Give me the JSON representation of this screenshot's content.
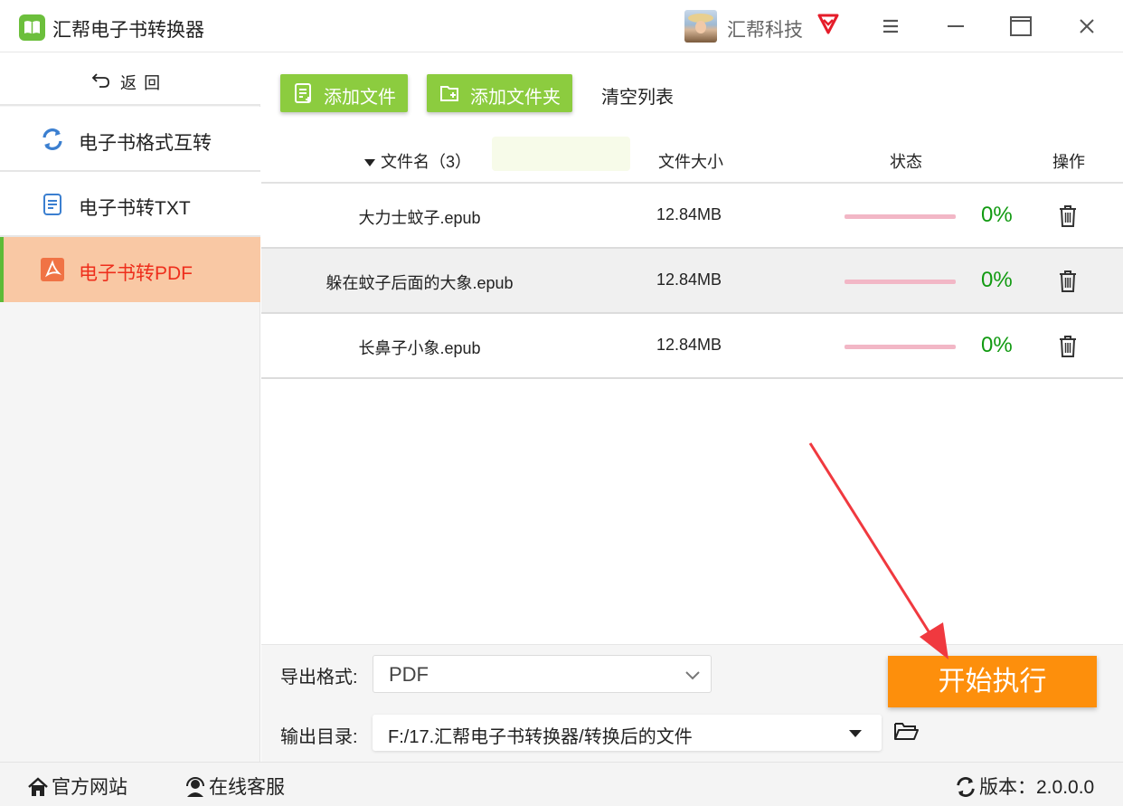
{
  "app": {
    "title": "汇帮电子书转换器",
    "company": "汇帮科技"
  },
  "sidebar": {
    "back_label": "返回",
    "items": [
      {
        "label": "电子书格式互转",
        "icon": "refresh-icon",
        "active": false
      },
      {
        "label": "电子书转TXT",
        "icon": "document-icon",
        "active": false
      },
      {
        "label": "电子书转PDF",
        "icon": "pdf-icon",
        "active": true
      }
    ]
  },
  "toolbar": {
    "add_file": "添加文件",
    "add_folder": "添加文件夹",
    "clear_list": "清空列表"
  },
  "table": {
    "headers": {
      "name": "文件名（3）",
      "size": "文件大小",
      "status": "状态",
      "action": "操作"
    },
    "rows": [
      {
        "name": "大力士蚊子.epub",
        "size": "12.84MB",
        "progress": 0,
        "percent": "0%"
      },
      {
        "name": "躲在蚊子后面的大象.epub",
        "size": "12.84MB",
        "progress": 0,
        "percent": "0%"
      },
      {
        "name": "长鼻子小象.epub",
        "size": "12.84MB",
        "progress": 0,
        "percent": "0%"
      }
    ]
  },
  "settings": {
    "format_label": "导出格式:",
    "format_value": "PDF",
    "output_label": "输出目录:",
    "output_value": "F:/17.汇帮电子书转换器/转换后的文件",
    "start_button": "开始执行"
  },
  "statusbar": {
    "website": "官方网站",
    "support": "在线客服",
    "version": "版本：2.0.0.0"
  },
  "colors": {
    "accent_green": "#8ccc3f",
    "active_item_bg": "#f9c8a4",
    "active_item_text": "#ee2e1c",
    "start_button": "#fd8f0c",
    "percent_text": "#119a11",
    "progress_track": "#f2b7c6"
  }
}
